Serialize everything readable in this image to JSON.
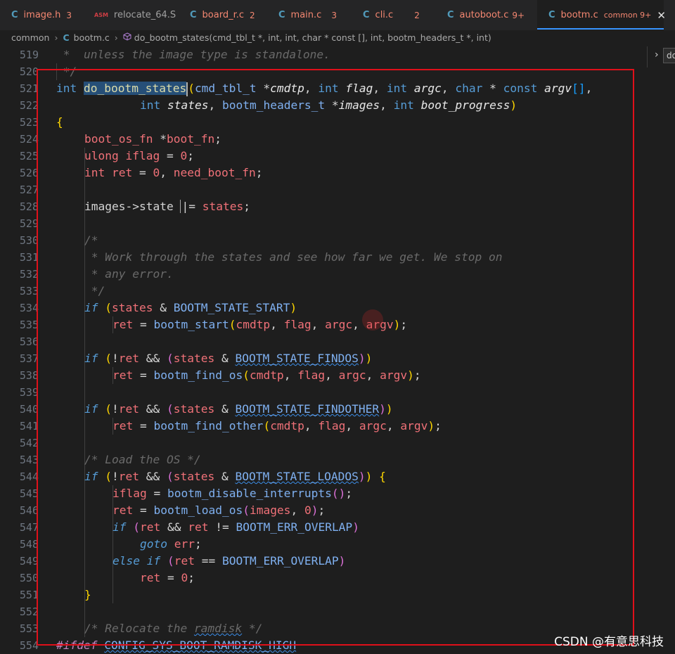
{
  "tabs": [
    {
      "icon": "C",
      "label": "image.h",
      "count": "3"
    },
    {
      "icon": "ASM",
      "label": "relocate_64.S",
      "count": ""
    },
    {
      "icon": "C",
      "label": "board_r.c",
      "count": "2"
    },
    {
      "icon": "C",
      "label": "main.c",
      "count": "3"
    },
    {
      "icon": "C",
      "label": "cli.c",
      "count": "2"
    },
    {
      "icon": "C",
      "label": "autoboot.c",
      "count": "9+"
    },
    {
      "icon": "C",
      "label": "bootm.c",
      "folder": "common",
      "count": "9+",
      "close": "✕"
    }
  ],
  "breadcrumb": {
    "folder": "common",
    "file_icon": "C",
    "file": "bootm.c",
    "symbol_icon": "cube-icon",
    "symbol": "do_bootm_states(cmd_tbl_t *, int, int, char * const [], int, bootm_headers_t *, int)"
  },
  "outline": {
    "chevron": "›",
    "label": "do"
  },
  "watermark": "CSDN @有意思科技",
  "editor": {
    "line_numbers": [
      "519",
      "520",
      "521",
      "522",
      "523",
      "524",
      "525",
      "526",
      "527",
      "528",
      "529",
      "530",
      "531",
      "532",
      "533",
      "534",
      "535",
      "536",
      "537",
      "538",
      "539",
      "540",
      "541",
      "542",
      "543",
      "544",
      "545",
      "546",
      "547",
      "548",
      "549",
      "550",
      "551",
      "552",
      "553",
      "554"
    ],
    "tokens": {
      "t519": " *  unless the image type is standalone.",
      "t520": " */",
      "int": "int",
      "fname": "do_bootm_states",
      "p1type": "cmd_tbl_t",
      "p1name": "cmdtp",
      "p2name": "flag",
      "p3name": "argc",
      "char": "char",
      "const": "const",
      "p4name": "argv",
      "p5name": "states",
      "p6type": "bootm_headers_t",
      "p6name": "images",
      "p7name": "boot_progress",
      "brace_open": "{",
      "brace_close": "}",
      "l524_type": "boot_os_fn",
      "l524_var": "boot_fn",
      "ulong": "ulong",
      "iflag": "iflag",
      "zero": "0",
      "ret": "ret",
      "need_boot_fn": "need_boot_fn",
      "images": "images",
      "arrow": "->",
      "state": "state",
      "orassign": "|=",
      "states": "states",
      "c530": "/*",
      "c531": " * Work through the states and see how far we get. We stop on",
      "c532": " * any error.",
      "c533": " */",
      "if": "if",
      "else": "else",
      "goto": "goto",
      "err": "err",
      "S_START": "BOOTM_STATE_START",
      "S_FINDOS": "BOOTM_STATE_FINDOS",
      "S_FINDOTHER": "BOOTM_STATE_FINDOTHER",
      "S_LOADOS": "BOOTM_STATE_LOADOS",
      "ERR_OVERLAP": "BOOTM_ERR_OVERLAP",
      "bootm_start": "bootm_start",
      "bootm_find_os": "bootm_find_os",
      "bootm_find_other": "bootm_find_other",
      "bootm_disable_interrupts": "bootm_disable_interrupts",
      "bootm_load_os": "bootm_load_os",
      "cmdtp": "cmdtp",
      "flag": "flag",
      "argc": "argc",
      "argv": "argv",
      "c543": "/* Load the OS */",
      "c553a": "/* Relocate the ",
      "c553b": "ramdisk",
      "c553c": " */",
      "ifdef": "#ifdef",
      "cfg": "CONFIG_SYS_BOOT_RAMDISK_HIGH"
    }
  },
  "colors": {
    "background": "#1e1e1e",
    "keyword": "#569cd6",
    "function": "#dcdcaa",
    "variable": "#f07178",
    "comment": "#6a6a6a",
    "highlight_box": "#e0101a",
    "tab_underline": "#3794ff"
  }
}
